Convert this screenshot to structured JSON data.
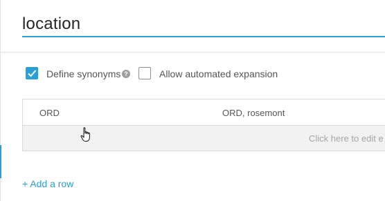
{
  "entity": {
    "name": "location"
  },
  "options": {
    "define_synonyms": {
      "label": "Define synonyms",
      "checked": true,
      "help_glyph": "?"
    },
    "automated_expansion": {
      "label": "Allow automated expansion",
      "checked": false
    }
  },
  "table": {
    "rows": [
      {
        "value": "ORD",
        "synonyms": "ORD, rosemont"
      }
    ],
    "new_row_placeholder": "Click here to edit e"
  },
  "actions": {
    "add_row_label": "+ Add a row"
  },
  "colors": {
    "accent": "#2a9fd8",
    "new_row_bg": "#f2f2f2",
    "border": "#dcdcdc"
  },
  "icons": {
    "checkbox_checked": "check-icon",
    "help": "help-icon",
    "cursor": "hand-pointer-icon"
  }
}
